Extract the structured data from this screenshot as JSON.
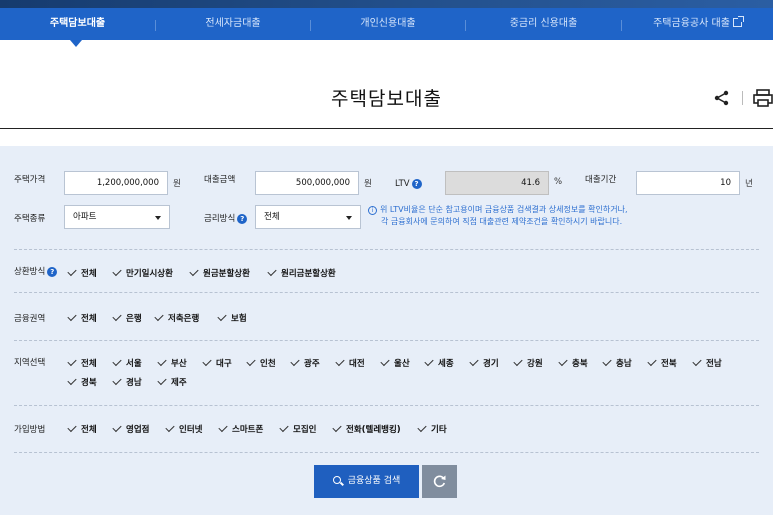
{
  "tabs": [
    {
      "label": "주택담보대출",
      "active": true
    },
    {
      "label": "전세자금대출",
      "active": false
    },
    {
      "label": "개인신용대출",
      "active": false
    },
    {
      "label": "중금리 신용대출",
      "active": false
    },
    {
      "label": "주택금융공사 대출",
      "active": false,
      "icon": "external-link-icon"
    }
  ],
  "page": {
    "title": "주택담보대출",
    "actions": [
      "share-icon",
      "print-icon"
    ]
  },
  "form": {
    "house_price_label": "주택가격",
    "house_price_value": "1,200,000,000",
    "house_price_unit": "원",
    "loan_amount_label": "대출금액",
    "loan_amount_value": "500,000,000",
    "loan_amount_unit": "원",
    "ltv_label": "LTV",
    "ltv_value": "41.6",
    "ltv_unit": "%",
    "loan_period_label": "대출기간",
    "loan_period_value": "10",
    "loan_period_unit": "년",
    "house_type_label": "주택종류",
    "house_type_value": "아파트",
    "rate_type_label": "금리방식",
    "rate_type_value": "전체",
    "help_glyph": "?",
    "notice_icon": "i",
    "notice_line1": "위 LTV비율은 단순 참고용이며 금융상품 검색결과 상세정보를 확인하거나,",
    "notice_line2": "각 금융회사에 문의하여 직접 대출관련 제약조건을 확인하시기 바랍니다."
  },
  "filters": {
    "repayment": {
      "label": "상환방식",
      "options": [
        "전체",
        "만기일시상환",
        "원금분할상환",
        "원리금분할상환"
      ]
    },
    "sector": {
      "label": "금융권역",
      "options": [
        "전체",
        "은행",
        "저축은행",
        "보험"
      ]
    },
    "region": {
      "label": "지역선택",
      "options": [
        "전체",
        "서울",
        "부산",
        "대구",
        "인천",
        "광주",
        "대전",
        "울산",
        "세종",
        "경기",
        "강원",
        "충북",
        "충남",
        "전북",
        "전남",
        "경북",
        "경남",
        "제주"
      ]
    },
    "channel": {
      "label": "가입방법",
      "options": [
        "전체",
        "영업점",
        "인터넷",
        "스마트폰",
        "모집인",
        "전화(텔레뱅킹)",
        "기타"
      ]
    }
  },
  "buttons": {
    "search_label": "금융상품 검색",
    "reset_icon": "refresh-icon"
  },
  "colors": {
    "primary": "#1f64c8",
    "panel_bg": "#e7eef8",
    "notice_text": "#2d6fd0",
    "reset_bg": "#808d9e"
  }
}
